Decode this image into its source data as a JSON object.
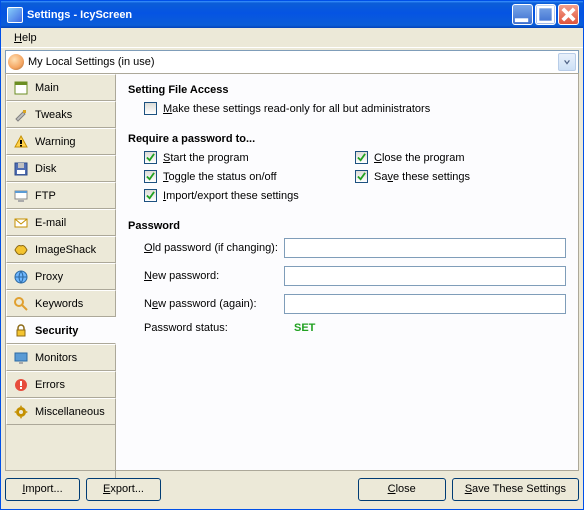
{
  "title": "Settings - IcyScreen",
  "menubar": {
    "help": "Help"
  },
  "profile": {
    "text": "My Local Settings (in use)"
  },
  "sidebar": {
    "items": [
      {
        "label": "Main",
        "name": "main"
      },
      {
        "label": "Tweaks",
        "name": "tweaks"
      },
      {
        "label": "Warning",
        "name": "warning"
      },
      {
        "label": "Disk",
        "name": "disk"
      },
      {
        "label": "FTP",
        "name": "ftp"
      },
      {
        "label": "E-mail",
        "name": "email"
      },
      {
        "label": "ImageShack",
        "name": "imageshack"
      },
      {
        "label": "Proxy",
        "name": "proxy"
      },
      {
        "label": "Keywords",
        "name": "keywords"
      },
      {
        "label": "Security",
        "name": "security"
      },
      {
        "label": "Monitors",
        "name": "monitors"
      },
      {
        "label": "Errors",
        "name": "errors"
      },
      {
        "label": "Miscellaneous",
        "name": "miscellaneous"
      }
    ],
    "active": 9
  },
  "content": {
    "file_access_title": "Setting File Access",
    "readonly_label": "Make these settings read-only for all but administrators",
    "require_title": "Require a password to...",
    "opts": {
      "start": "Start the program",
      "close": "Close the program",
      "toggle": "Toggle the status on/off",
      "save": "Save these settings",
      "import": "Import/export these settings"
    },
    "password_title": "Password",
    "old_label": "Old password (if changing):",
    "new_label": "New password:",
    "again_label": "New password (again):",
    "status_label": "Password status:",
    "status_value": "SET"
  },
  "footer": {
    "import": "Import...",
    "export": "Export...",
    "close": "Close",
    "save": "Save These Settings"
  },
  "accel": {
    "help": "H",
    "readonly": "M",
    "start": "S",
    "closep": "C",
    "toggle": "T",
    "savep": "v",
    "import": "I",
    "old": "O",
    "new": "N",
    "again": "e",
    "importbtn": "I",
    "export": "E",
    "close": "C",
    "save": "S"
  }
}
